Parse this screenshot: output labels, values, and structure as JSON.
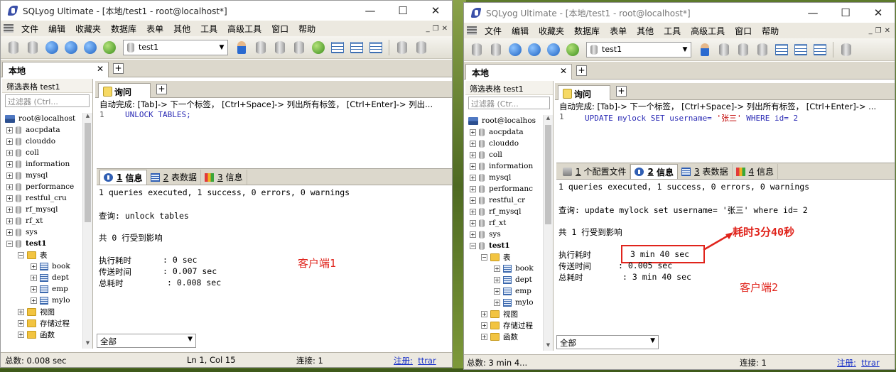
{
  "windows": [
    {
      "title": "SQLyog Ultimate - [本地/test1 - root@localhost*]",
      "menu": [
        "文件",
        "编辑",
        "收藏夹",
        "数据库",
        "表单",
        "其他",
        "工具",
        "高级工具",
        "窗口",
        "帮助"
      ],
      "db_selector": "test1",
      "connection_tab": "本地",
      "filter_label": "筛选表格 test1",
      "filter_placeholder": "过滤器 (Ctrl...",
      "tree": {
        "server": "root@localhost",
        "databases": [
          "aocpdata",
          "clouddo",
          "coll",
          "information",
          "mysql",
          "performance",
          "restful_cru",
          "rf_mysql",
          "rf_xt",
          "sys"
        ],
        "current_db": "test1",
        "tables_folder": "表",
        "tables": [
          "book",
          "dept",
          "emp",
          "mylo"
        ],
        "other_folders": [
          "视图",
          "存储过程",
          "函数"
        ]
      },
      "query_tab": "询问",
      "hint": "自动完成: [Tab]-> 下一个标签， [Ctrl+Space]-> 列出所有标签， [Ctrl+Enter]-> 列出...",
      "line_no": "1",
      "code": "UNLOCK TABLES;",
      "result_tabs": [
        {
          "num": "1",
          "label": "信息",
          "icon": "info-icon"
        },
        {
          "num": "2",
          "label": "表数据",
          "icon": "grid-icon"
        },
        {
          "num": "3",
          "label": "信息",
          "icon": "multi-info-icon"
        }
      ],
      "results": {
        "summary": "1 queries executed, 1 success, 0 errors, 0 warnings",
        "query": "查询: unlock tables",
        "affected": "共 0 行受到影响",
        "exec_label": "执行耗时",
        "exec_value": ": 0 sec",
        "transfer_label": "传送时间",
        "transfer_value": ": 0.007 sec",
        "total_label": "总耗时",
        "total_value": ": 0.008 sec"
      },
      "client_label": "客户端1",
      "bottom_select": "全部",
      "status": {
        "total": "总数: 0.008 sec",
        "pos": "Ln 1, Col 15",
        "conn": "连接: 1",
        "reg_label": "注册:",
        "reg_user": "ttrar"
      }
    },
    {
      "title": "SQLyog Ultimate - [本地/test1 - root@localhost*]",
      "menu": [
        "文件",
        "编辑",
        "收藏夹",
        "数据库",
        "表单",
        "其他",
        "工具",
        "高级工具",
        "窗口",
        "帮助"
      ],
      "db_selector": "test1",
      "connection_tab": "本地",
      "filter_label": "筛选表格 test1",
      "filter_placeholder": "过滤器 (Ctr...",
      "tree": {
        "server": "root@localhos",
        "databases": [
          "aocpdata",
          "clouddo",
          "coll",
          "information",
          "mysql",
          "performanc",
          "restful_cr",
          "rf_mysql",
          "rf_xt",
          "sys"
        ],
        "current_db": "test1",
        "tables_folder": "表",
        "tables": [
          "book",
          "dept",
          "emp",
          "mylo"
        ],
        "other_folders": [
          "视图",
          "存储过程",
          "函数"
        ]
      },
      "query_tab": "询问",
      "hint": "自动完成: [Tab]-> 下一个标签， [Ctrl+Space]-> 列出所有标签， [Ctrl+Enter]-> ...",
      "line_no": "1",
      "code_pre": "UPDATE mylock SET username= ",
      "code_str": "'张三'",
      "code_post": " WHERE id= 2",
      "result_tabs": [
        {
          "num": "1",
          "label": "个配置文件",
          "icon": "profile-icon"
        },
        {
          "num": "2",
          "label": "信息",
          "icon": "info-icon"
        },
        {
          "num": "3",
          "label": "表数据",
          "icon": "grid-icon"
        },
        {
          "num": "4",
          "label": "信息",
          "icon": "multi-info-icon"
        }
      ],
      "results": {
        "summary": "1 queries executed, 1 success, 0 errors, 0 warnings",
        "query": "查询: update mylock set username= '张三' where id= 2",
        "affected": "共 1 行受到影响",
        "exec_label": "执行耗时",
        "exec_value": "3 min 40 sec",
        "transfer_label": "传送时间",
        "transfer_value": ": 0.005 sec",
        "total_label": "总耗时",
        "total_value": ": 3 min 40 sec"
      },
      "annotation": "耗时3分40秒",
      "client_label": "客户端2",
      "bottom_select": "全部",
      "status": {
        "total": "总数: 3 min 4...",
        "conn": "连接: 1",
        "reg_label": "注册:",
        "reg_user": "ttrar"
      }
    }
  ],
  "colors": {
    "annotation": "#e0241c",
    "keyword": "#2a2ab4",
    "string": "#c00000",
    "link": "#1a32c8"
  }
}
